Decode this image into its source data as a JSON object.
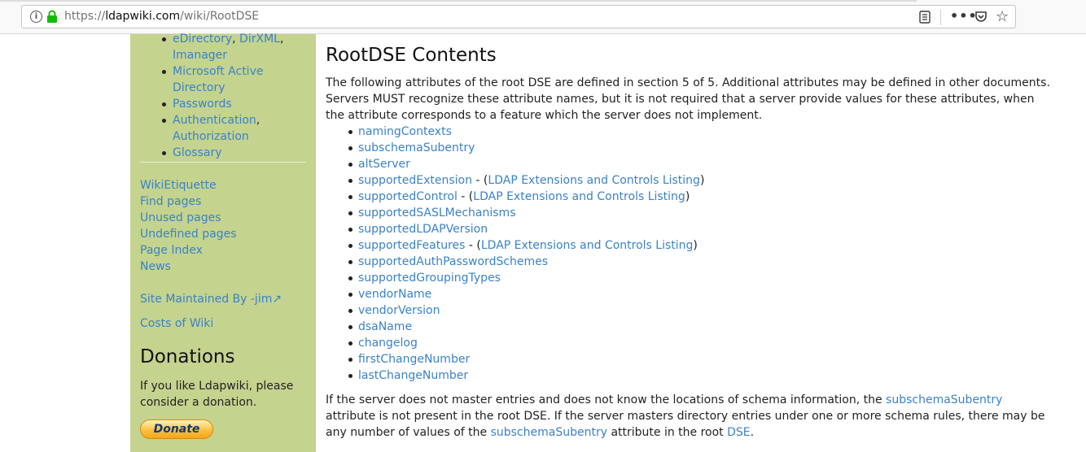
{
  "browser": {
    "url_scheme": "https://",
    "url_host": "ldapwiki.com",
    "url_path": "/wiki/RootDSE",
    "info_glyph": "i",
    "more_glyph": "•••",
    "star_glyph": "☆"
  },
  "sidebar": {
    "top_items": [
      {
        "parts": [
          {
            "text": "eDirectory",
            "link": true
          },
          {
            "text": ", ",
            "link": false
          },
          {
            "text": "DirXML",
            "link": true
          },
          {
            "text": ",",
            "link": false
          }
        ]
      },
      {
        "parts": [
          {
            "text": "Imanager",
            "link": true
          }
        ]
      },
      {
        "parts": [
          {
            "text": "Microsoft Active Directory",
            "link": true
          }
        ]
      },
      {
        "parts": [
          {
            "text": "Passwords",
            "link": true
          }
        ]
      },
      {
        "parts": [
          {
            "text": "Authentication",
            "link": true
          },
          {
            "text": ",",
            "link": false
          }
        ]
      },
      {
        "parts": [
          {
            "text": "Authorization",
            "link": true
          }
        ]
      },
      {
        "parts": [
          {
            "text": "Glossary",
            "link": true
          }
        ]
      }
    ],
    "links": [
      "WikiEtiquette",
      "Find pages",
      "Unused pages",
      "Undefined pages",
      "Page Index",
      "News"
    ],
    "maintained": "Site Maintained By -jim",
    "maintained_glyph": "↗",
    "costs": "Costs of Wiki",
    "donations_heading": "Donations",
    "donate_text": "If you like Ldapwiki, please consider a donation.",
    "donate_button": "Donate"
  },
  "main": {
    "title": "RootDSE Contents",
    "intro": "The following attributes of the root DSE are defined in section 5 of 5. Additional attributes may be defined in other documents. Servers MUST recognize these attribute names, but it is not required that a server provide values for these attributes, when the attribute corresponds to a feature which the server does not implement.",
    "attributes": [
      {
        "name": "namingContexts"
      },
      {
        "name": "subschemaSubentry"
      },
      {
        "name": "altServer"
      },
      {
        "name": "supportedExtension",
        "suffix_pre": " - (",
        "ref": "LDAP Extensions and Controls Listing",
        "suffix_post": ")"
      },
      {
        "name": "supportedControl",
        "suffix_pre": " - (",
        "ref": "LDAP Extensions and Controls Listing",
        "suffix_post": ")"
      },
      {
        "name": "supportedSASLMechanisms"
      },
      {
        "name": "supportedLDAPVersion"
      },
      {
        "name": "supportedFeatures",
        "suffix_pre": " - (",
        "ref": "LDAP Extensions and Controls Listing",
        "suffix_post": ")"
      },
      {
        "name": "supportedAuthPasswordSchemes"
      },
      {
        "name": "supportedGroupingTypes"
      },
      {
        "name": "vendorName"
      },
      {
        "name": "vendorVersion"
      },
      {
        "name": "dsaName"
      },
      {
        "name": "changelog"
      },
      {
        "name": "firstChangeNumber"
      },
      {
        "name": "lastChangeNumber"
      }
    ],
    "outro": {
      "t1": "If the server does not master entries and does not know the locations of schema information, the ",
      "l1": "subschemaSubentry",
      "t2": " attribute is not present in the root DSE. If the server masters directory entries under one or more schema rules, there may be any number of values of the ",
      "l2": "subschemaSubentry",
      "t3": " attribute in the root ",
      "l3": "DSE",
      "t4": "."
    }
  },
  "colors": {
    "link": "#3a82c8",
    "sidebar_bg": "#c4d38e",
    "lock_green": "#12bc00"
  }
}
